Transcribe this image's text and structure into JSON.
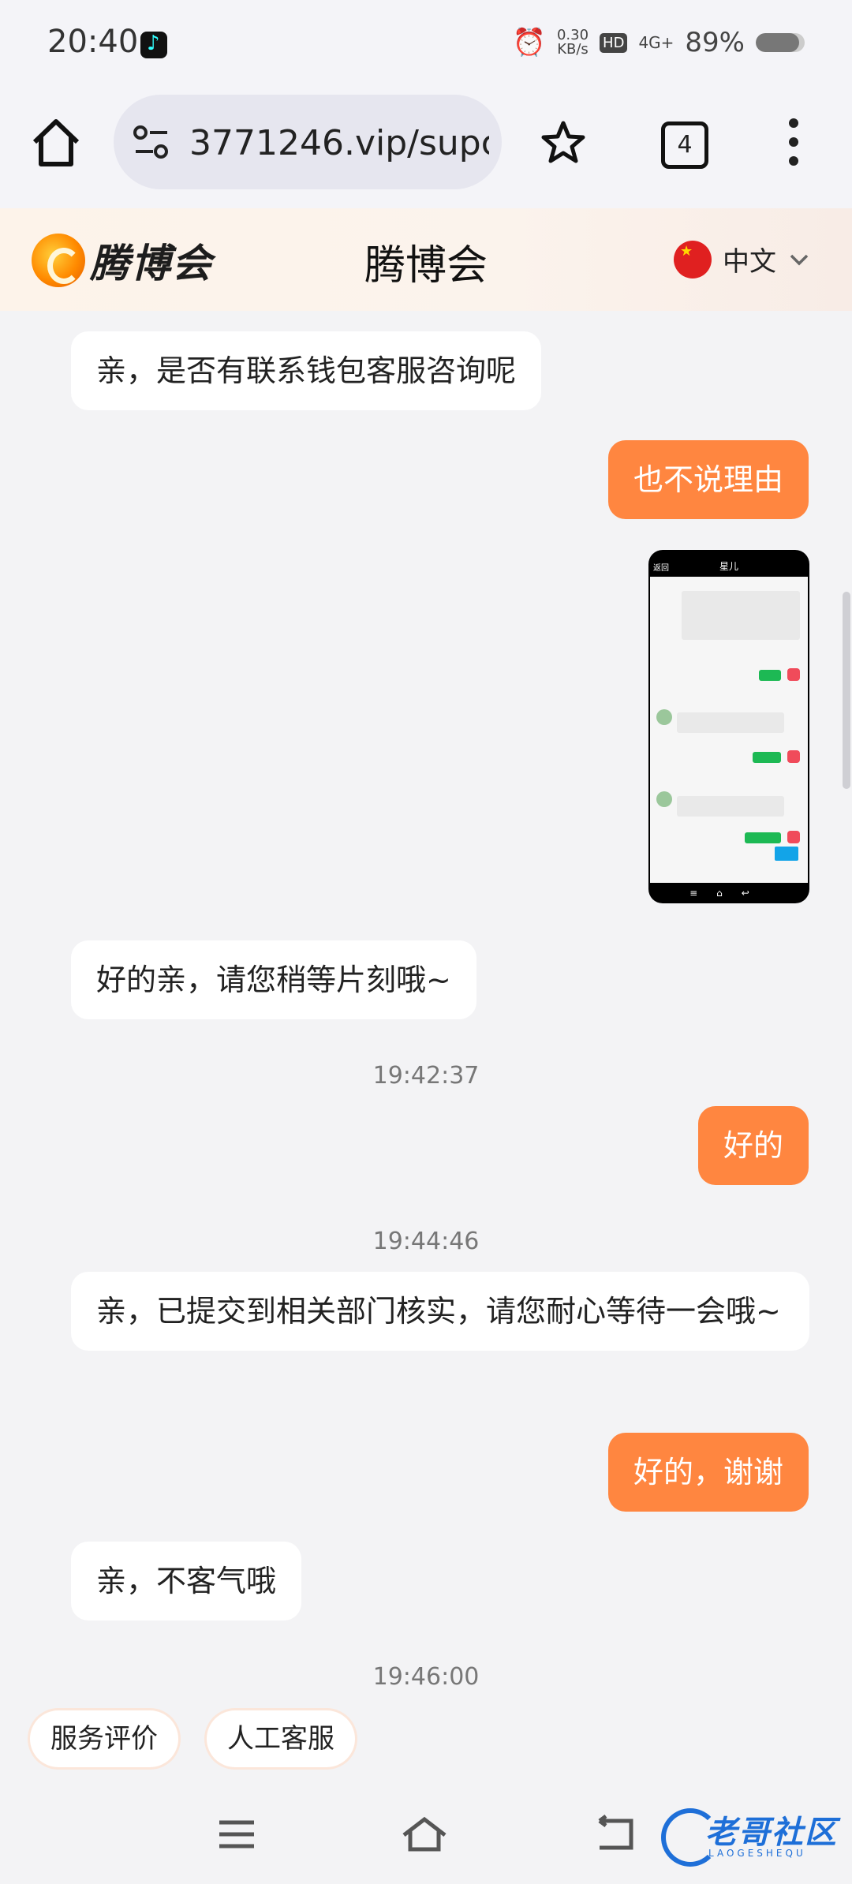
{
  "status_bar": {
    "time": "20:40",
    "net_speed_value": "0.30",
    "net_speed_unit": "KB/s",
    "hd_badge": "HD",
    "network": "4G+",
    "battery_text": "89%",
    "battery_level": 0.89
  },
  "browser": {
    "url": "3771246.vip/supcs",
    "tab_count": "4"
  },
  "header": {
    "logo_text": "腾博会",
    "title": "腾博会",
    "language": "中文"
  },
  "chat": {
    "messages": [
      {
        "side": "left",
        "text": "亲，是否有联系钱包客服咨询呢"
      },
      {
        "side": "right",
        "text": "也不说理由"
      },
      {
        "side": "right",
        "type": "image",
        "image_title": "星儿",
        "image_back": "返回"
      },
      {
        "side": "left",
        "text": "好的亲，请您稍等片刻哦~"
      },
      {
        "time": "19:42:37"
      },
      {
        "side": "right",
        "text": "好的"
      },
      {
        "time": "19:44:46"
      },
      {
        "side": "left",
        "text": "亲，已提交到相关部门核实，请您耐心等待一会哦~"
      },
      {
        "side": "right",
        "text": "好的，谢谢"
      },
      {
        "side": "left",
        "text": "亲，不客气哦"
      },
      {
        "time": "19:46:00"
      }
    ]
  },
  "quick_actions": {
    "rate_service": "服务评价",
    "human_agent": "人工客服"
  },
  "watermark": {
    "title": "老哥社区",
    "subtitle": "LAOGESHEQU"
  },
  "colors": {
    "accent_bubble": "#ff8640",
    "page_bg": "#f3f3f5"
  }
}
